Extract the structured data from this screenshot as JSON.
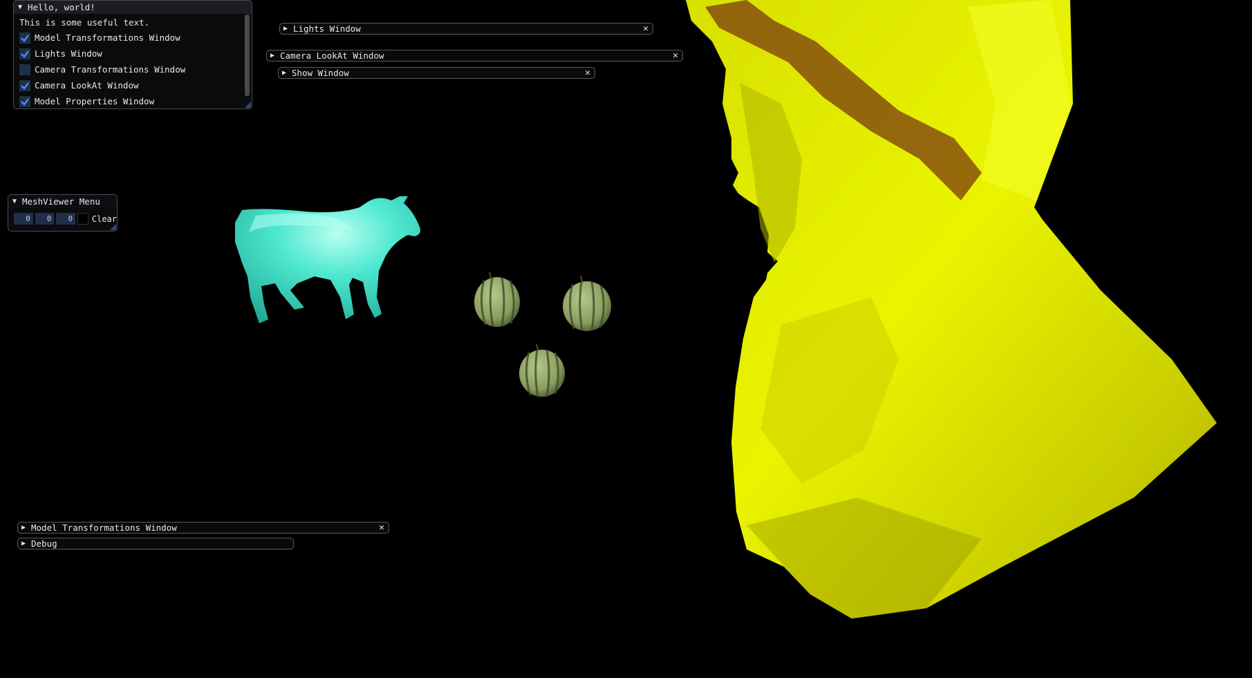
{
  "hello_window": {
    "title": "Hello, world!",
    "text": "This is some useful text.",
    "checkboxes": [
      {
        "label": "Model Transformations Window",
        "checked": true
      },
      {
        "label": "Lights Window",
        "checked": true
      },
      {
        "label": "Camera Transformations Window",
        "checked": false
      },
      {
        "label": "Camera LookAt Window",
        "checked": true
      },
      {
        "label": "Model Properties Window",
        "checked": true
      }
    ]
  },
  "collapsed_windows": {
    "lights": "Lights Window",
    "camera_lookat": "Camera LookAt Window",
    "show": "Show Window",
    "model_transformations": "Model Transformations Window",
    "debug": "Debug"
  },
  "meshviewer_menu": {
    "title": "MeshViewer Menu",
    "values": [
      "0",
      "0",
      "0"
    ],
    "clear_label": "Clear"
  },
  "colors": {
    "background": "#000000",
    "cow": "#40e0c8",
    "bust": "#e6f000",
    "checkbox_check": "#4a90e8"
  },
  "icons": {
    "expanded": "triangle-down-icon",
    "collapsed": "triangle-right-icon",
    "close": "close-x-icon",
    "check": "check-icon"
  }
}
